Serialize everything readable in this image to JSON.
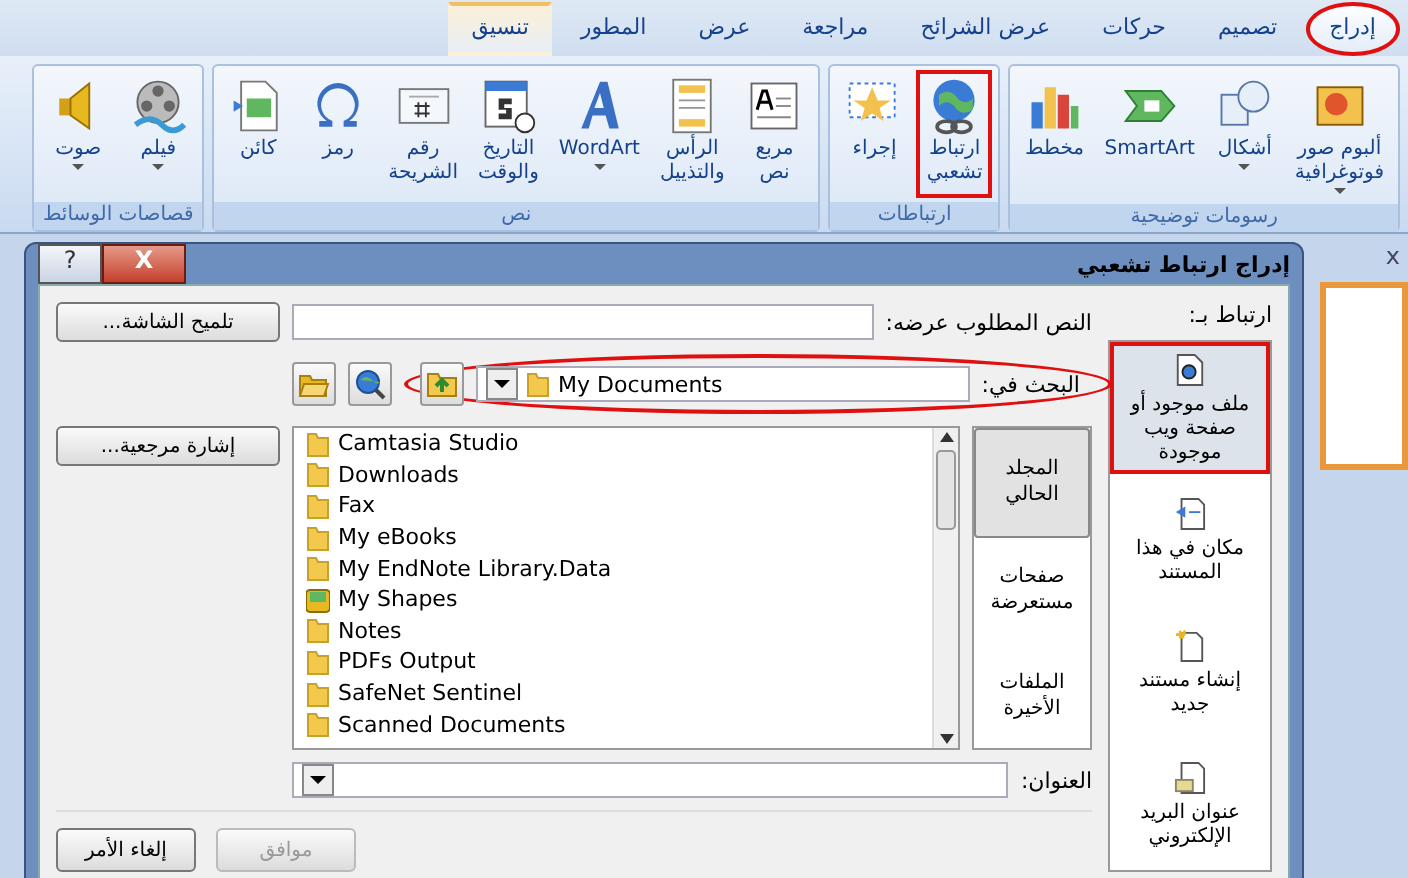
{
  "ribbon": {
    "tabs": [
      {
        "label": "إدراج",
        "selected": true,
        "highlighted": true,
        "kind": "normal"
      },
      {
        "label": "تصميم",
        "selected": false,
        "highlighted": false,
        "kind": "normal"
      },
      {
        "label": "حركات",
        "selected": false,
        "highlighted": false,
        "kind": "normal"
      },
      {
        "label": "عرض الشرائح",
        "selected": false,
        "highlighted": false,
        "kind": "normal"
      },
      {
        "label": "مراجعة",
        "selected": false,
        "highlighted": false,
        "kind": "normal"
      },
      {
        "label": "عرض",
        "selected": false,
        "highlighted": false,
        "kind": "normal"
      },
      {
        "label": "المطور",
        "selected": false,
        "highlighted": false,
        "kind": "normal"
      },
      {
        "label": "تنسيق",
        "selected": false,
        "highlighted": false,
        "kind": "contextual"
      }
    ],
    "groups": [
      {
        "label": "رسومات توضيحية",
        "buttons": [
          {
            "label": "ألبوم صور\nفوتوغرافية",
            "kind": "photo",
            "dropdown": true,
            "highlighted": false
          },
          {
            "label": "أشكال",
            "kind": "shapes",
            "dropdown": true,
            "highlighted": false
          },
          {
            "label": "SmartArt",
            "kind": "smartart",
            "dropdown": false,
            "highlighted": false
          },
          {
            "label": "مخطط",
            "kind": "chart",
            "dropdown": false,
            "highlighted": false
          }
        ]
      },
      {
        "label": "ارتباطات",
        "buttons": [
          {
            "label": "ارتباط\nتشعبي",
            "kind": "hyperlink",
            "dropdown": false,
            "highlighted": true
          },
          {
            "label": "إجراء",
            "kind": "action",
            "dropdown": false,
            "highlighted": false
          }
        ]
      },
      {
        "label": "نص",
        "buttons": [
          {
            "label": "مربع\nنص",
            "kind": "textbox",
            "dropdown": false,
            "highlighted": false
          },
          {
            "label": "الرأس\nوالتذييل",
            "kind": "header",
            "dropdown": false,
            "highlighted": false
          },
          {
            "label": "WordArt",
            "kind": "wordart",
            "dropdown": true,
            "highlighted": false
          },
          {
            "label": "التاريخ\nوالوقت",
            "kind": "datetime",
            "dropdown": false,
            "highlighted": false
          },
          {
            "label": "رقم\nالشريحة",
            "kind": "slidenumber",
            "dropdown": false,
            "highlighted": false
          },
          {
            "label": "رمز",
            "kind": "symbol",
            "dropdown": false,
            "highlighted": false
          },
          {
            "label": "كائن",
            "kind": "object",
            "dropdown": false,
            "highlighted": false
          }
        ]
      },
      {
        "label": "قصاصات الوسائط",
        "buttons": [
          {
            "label": "فيلم",
            "kind": "movie",
            "dropdown": true,
            "highlighted": false
          },
          {
            "label": "صوت",
            "kind": "sound",
            "dropdown": true,
            "highlighted": false
          }
        ]
      }
    ]
  },
  "side_panel": {
    "close": "x"
  },
  "dialog": {
    "title": "إدراج ارتباط تشعبي",
    "help": "?",
    "close": "X",
    "link_to_label": "ارتباط بـ:",
    "link_types": [
      {
        "label": "ملف موجود أو\nصفحة ويب\nموجودة",
        "kind": "file",
        "selected": true,
        "highlighted": true
      },
      {
        "label": "مكان في هذا\nالمستند",
        "kind": "place",
        "selected": false,
        "highlighted": false
      },
      {
        "label": "إنشاء مستند\nجديد",
        "kind": "new",
        "selected": false,
        "highlighted": false
      },
      {
        "label": "عنوان البريد\nالإلكتروني",
        "kind": "email",
        "selected": false,
        "highlighted": false
      }
    ],
    "text_to_display": {
      "label": "النص المطلوب عرضه:"
    },
    "screentip_button": "تلميح الشاشة...",
    "look_in": {
      "label": "البحث في:",
      "value": "My Documents",
      "highlighted": true
    },
    "browse_tabs": [
      {
        "label": "المجلد\nالحالي",
        "selected": true
      },
      {
        "label": "صفحات\nمستعرضة",
        "selected": false
      },
      {
        "label": "الملفات\nالأخيرة",
        "selected": false
      }
    ],
    "files": [
      {
        "name": "Camtasia Studio",
        "kind": "folder"
      },
      {
        "name": "Downloads",
        "kind": "folder"
      },
      {
        "name": "Fax",
        "kind": "folder"
      },
      {
        "name": "My eBooks",
        "kind": "folder"
      },
      {
        "name": "My EndNote Library.Data",
        "kind": "folder"
      },
      {
        "name": "My Shapes",
        "kind": "special"
      },
      {
        "name": "Notes",
        "kind": "folder"
      },
      {
        "name": "PDFs Output",
        "kind": "folder"
      },
      {
        "name": "SafeNet Sentinel",
        "kind": "folder"
      },
      {
        "name": "Scanned Documents",
        "kind": "folder"
      }
    ],
    "bookmark_button": "إشارة مرجعية...",
    "address": {
      "label": "العنوان:"
    },
    "ok_button": {
      "label": "موافق",
      "disabled": true
    },
    "cancel_button": "إلغاء الأمر"
  }
}
